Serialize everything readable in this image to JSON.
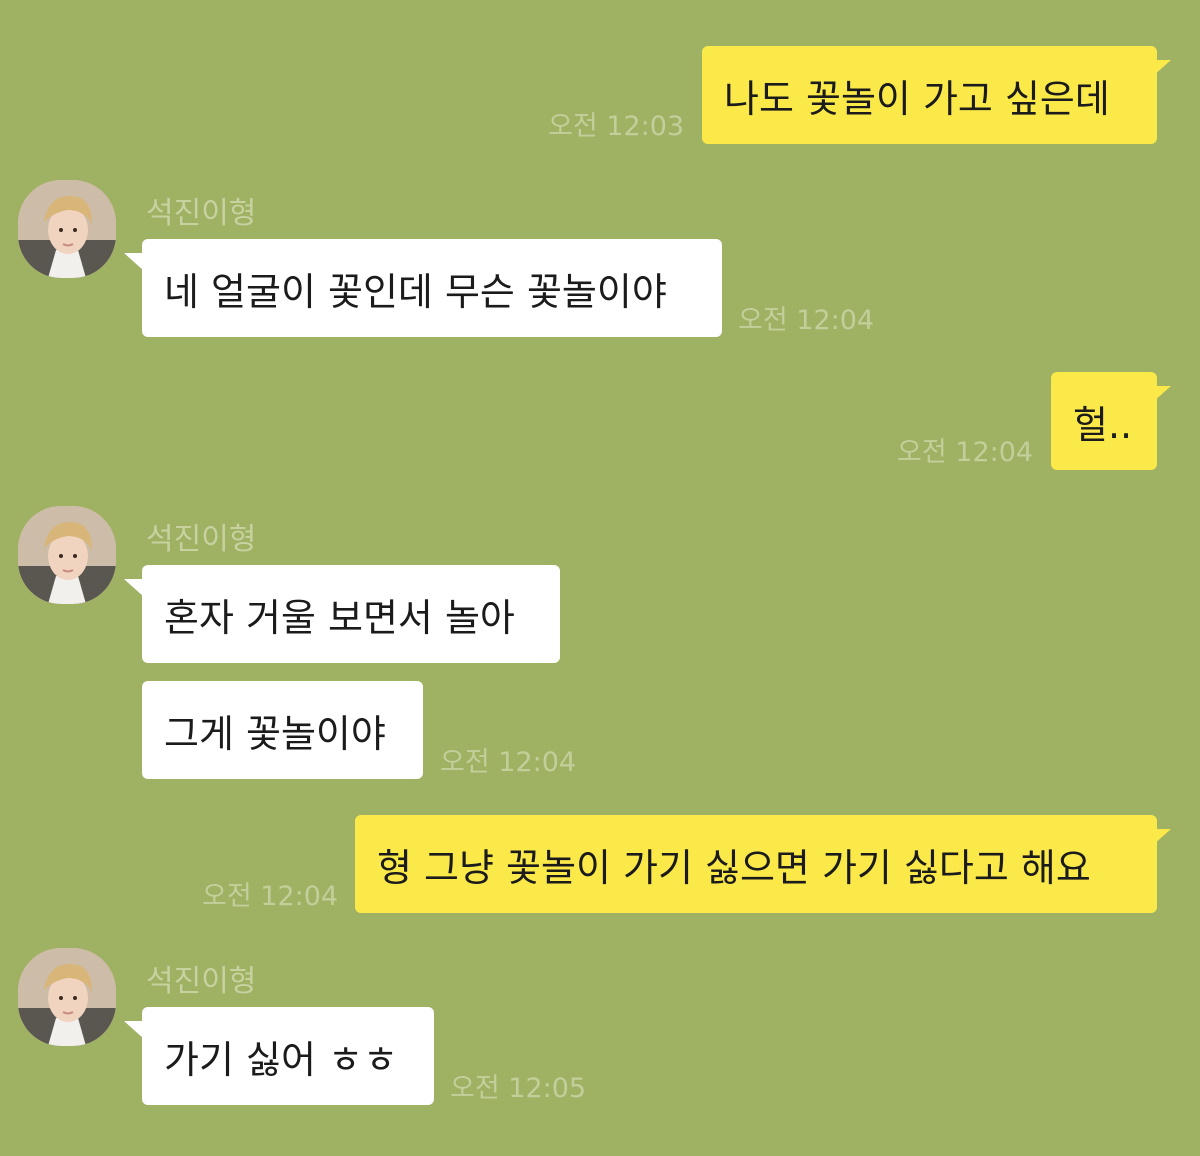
{
  "contact": {
    "name": "석진이형"
  },
  "messages": [
    {
      "from": "me",
      "text": "나도 꽃놀이 가고 싶은데",
      "time": "오전 12:03"
    },
    {
      "from": "contact",
      "text": "네 얼굴이 꽃인데 무슨 꽃놀이야",
      "time": "오전 12:04"
    },
    {
      "from": "me",
      "text": "헐..",
      "time": "오전 12:04"
    },
    {
      "from": "contact",
      "text": "혼자 거울 보면서 놀아"
    },
    {
      "from": "contact",
      "text": "그게 꽃놀이야",
      "time": "오전 12:04"
    },
    {
      "from": "me",
      "text": "형 그냥 꽃놀이 가기 싫으면 가기 싫다고 해요",
      "time": "오전 12:04"
    },
    {
      "from": "contact",
      "text": "가기 싫어 ㅎㅎ",
      "time": "오전 12:05"
    }
  ],
  "colors": {
    "background": "#9fb162",
    "outgoing_bubble": "#fbe94a",
    "incoming_bubble": "#ffffff",
    "timestamp": "#c3cf9a"
  },
  "icons": {
    "avatar": "profile-photo"
  }
}
